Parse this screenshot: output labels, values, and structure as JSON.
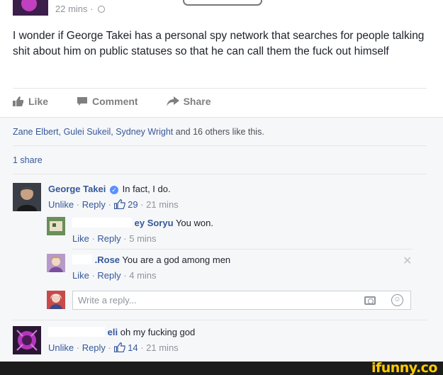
{
  "post": {
    "time": "22 mins",
    "text": "I wonder if George Takei has a personal spy network that searches for people talking shit about him on public statuses so that he can call them the fuck out himself"
  },
  "actions": {
    "like": "Like",
    "comment": "Comment",
    "share": "Share"
  },
  "likes": {
    "names": "Zane Elbert, Gulei Sukeil, Sydney Wright",
    "rest": " and 16 others like this."
  },
  "shares": "1 share",
  "comments": [
    {
      "name": "George Takei",
      "text": "In fact, I do.",
      "unlike": "Unlike",
      "reply": "Reply",
      "likes": "29",
      "time": "21 mins"
    },
    {
      "name": "ey Soryu",
      "text": "You won.",
      "like": "Like",
      "reply": "Reply",
      "time": "5 mins"
    },
    {
      "name": ".Rose",
      "text": "You are a god among men",
      "like": "Like",
      "reply": "Reply",
      "time": "4 mins"
    },
    {
      "name": "eli",
      "text": "oh my fucking god",
      "unlike": "Unlike",
      "reply": "Reply",
      "likes": "14",
      "time": "21 mins"
    }
  ],
  "reply_box": {
    "placeholder": "Write a reply..."
  },
  "watermark": "ifunny.co",
  "colors": {
    "link": "#365899",
    "muted": "#90949c",
    "watermark": "#ffcc00"
  }
}
